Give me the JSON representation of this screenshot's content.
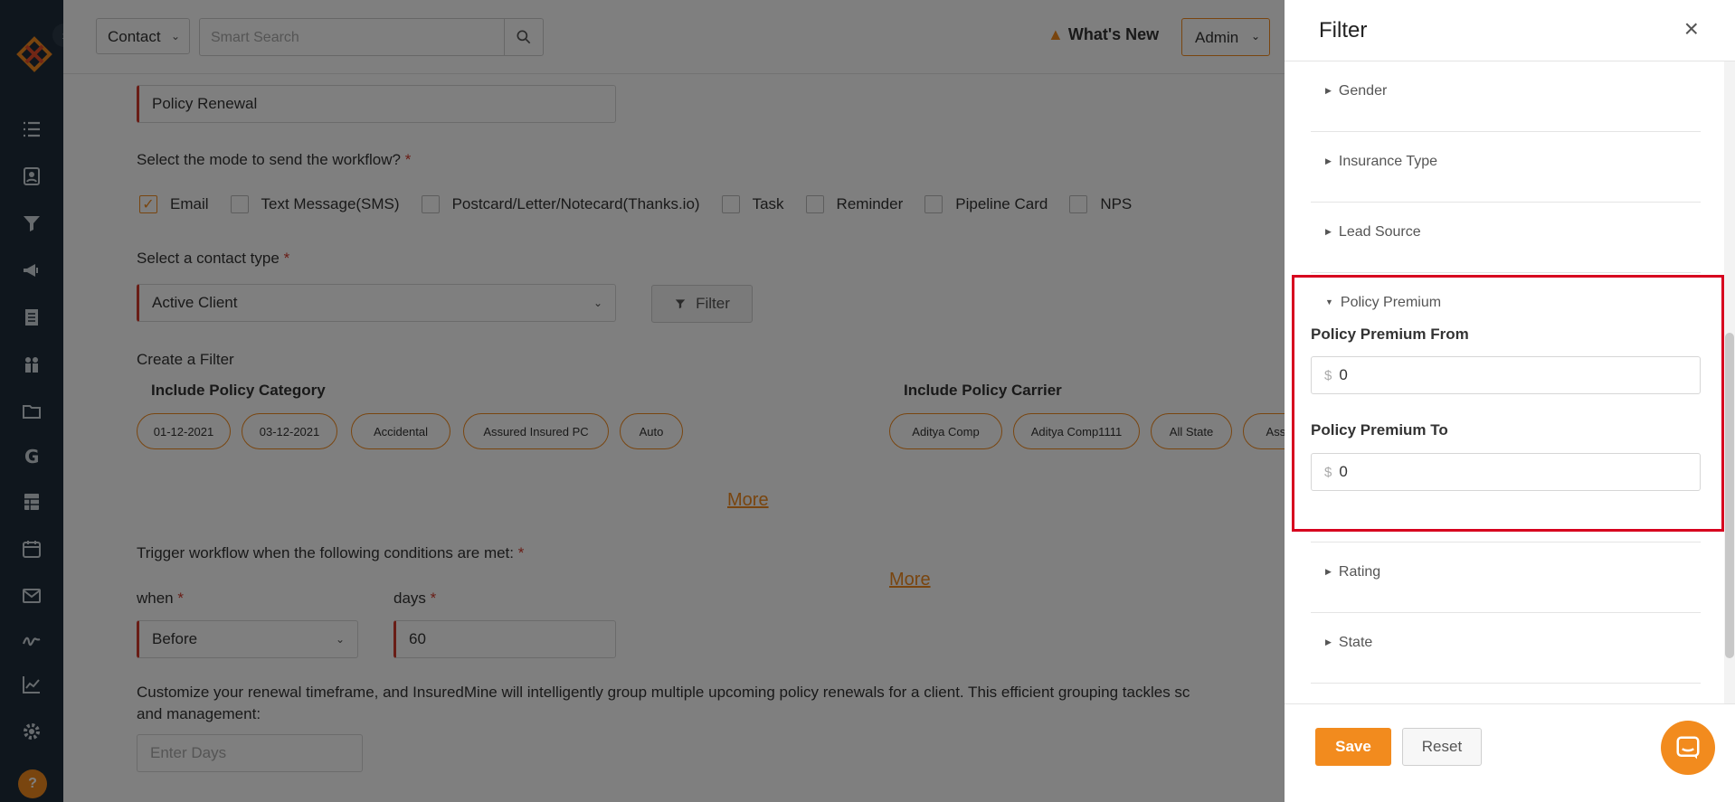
{
  "topbar": {
    "module_select": "Contact",
    "search_placeholder": "Smart Search",
    "whats_new": "What's New",
    "admin": "Admin"
  },
  "form": {
    "workflow_name_value": "Policy Renewal",
    "mode_question": "Select the mode to send the workflow?",
    "modes": [
      "Email",
      "Text Message(SMS)",
      "Postcard/Letter/Notecard(Thanks.io)",
      "Task",
      "Reminder",
      "Pipeline Card",
      "NPS"
    ],
    "mode_checked": "Email",
    "contact_type_label": "Select a contact type",
    "contact_type_value": "Active Client",
    "filter_button": "Filter",
    "create_filter": "Create a Filter",
    "include_policy_category": "Include Policy Category",
    "category_chips": [
      "01-12-2021",
      "03-12-2021",
      "Accidental",
      "Assured Insured PC",
      "Auto"
    ],
    "more_1": "More",
    "include_policy_carrier": "Include Policy Carrier",
    "carrier_chips": [
      "Aditya Comp",
      "Aditya Comp1111",
      "All State",
      "Assu"
    ],
    "more_2": "More",
    "trigger_label": "Trigger workflow when the following conditions are met:",
    "when_label": "when",
    "when_value": "Before",
    "days_label": "days",
    "days_value": "60",
    "customize_text": "Customize your renewal timeframe, and InsuredMine will intelligently group multiple upcoming policy renewals for a client. This efficient grouping tackles sc",
    "customize_text_2": "and management:",
    "enter_days_placeholder": "Enter Days"
  },
  "panel": {
    "title": "Filter",
    "sections": [
      "Gender",
      "Insurance Type",
      "Lead Source",
      "Policy Premium",
      "Rating",
      "State"
    ],
    "policy_premium_from_label": "Policy Premium From",
    "policy_premium_from_value": "0",
    "policy_premium_to_label": "Policy Premium To",
    "policy_premium_to_value": "0",
    "currency": "$",
    "save": "Save",
    "reset": "Reset"
  },
  "colors": {
    "accent": "#f28b1e",
    "sidebar": "#1f2d3a",
    "highlight": "#d7001f",
    "required": "#d23a2c"
  }
}
